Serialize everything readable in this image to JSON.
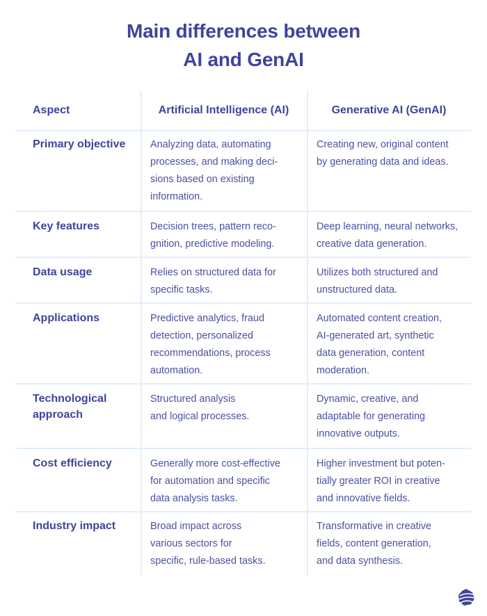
{
  "title": {
    "line1": "Main differences between",
    "line2": "AI and GenAI"
  },
  "colors": {
    "accent": "#3f449a",
    "body_text": "#4b50a0",
    "grid_lines": "#e4eefb",
    "background": "#ffffff"
  },
  "table": {
    "headers": [
      "Aspect",
      "Artificial Intelligence (AI)",
      "Generative AI (GenAI)"
    ],
    "rows": [
      {
        "aspect": [
          "Primary objective"
        ],
        "ai": [
          "Analyzing data, automating",
          "processes, and making deci-",
          "sions based on existing",
          "information."
        ],
        "genai": [
          "Creating new, original content",
          "by generating data and ideas."
        ]
      },
      {
        "aspect": [
          "Key features"
        ],
        "ai": [
          "Decision trees, pattern reco-",
          "gnition, predictive modeling."
        ],
        "genai": [
          "Deep learning, neural networks,",
          "creative data generation."
        ]
      },
      {
        "aspect": [
          "Data usage"
        ],
        "ai": [
          "Relies on structured data for",
          "specific tasks."
        ],
        "genai": [
          "Utilizes both structured and",
          "unstructured data."
        ]
      },
      {
        "aspect": [
          "Applications"
        ],
        "ai": [
          "Predictive analytics, fraud",
          "detection, personalized",
          "recommendations, process",
          "automation."
        ],
        "genai": [
          "Automated content creation,",
          "AI-generated art, synthetic",
          "data generation, content",
          "moderation."
        ]
      },
      {
        "aspect": [
          "Technological",
          "approach"
        ],
        "ai": [
          "Structured analysis",
          "and logical processes."
        ],
        "genai": [
          "Dynamic, creative, and",
          "adaptable for generating",
          "innovative outputs."
        ]
      },
      {
        "aspect": [
          "Cost efficiency"
        ],
        "ai": [
          "Generally more cost-effective",
          "for automation and specific",
          "data analysis tasks."
        ],
        "genai": [
          "Higher investment but poten-",
          "tially greater ROI in creative",
          "and innovative fields."
        ]
      },
      {
        "aspect": [
          "Industry impact"
        ],
        "ai": [
          "Broad impact across",
          "various sectors for",
          "specific, rule-based tasks."
        ],
        "genai": [
          "Transformative in creative",
          "fields, content generation,",
          "and data synthesis."
        ]
      }
    ]
  },
  "logo": {
    "icon": "brand-logo-icon"
  }
}
